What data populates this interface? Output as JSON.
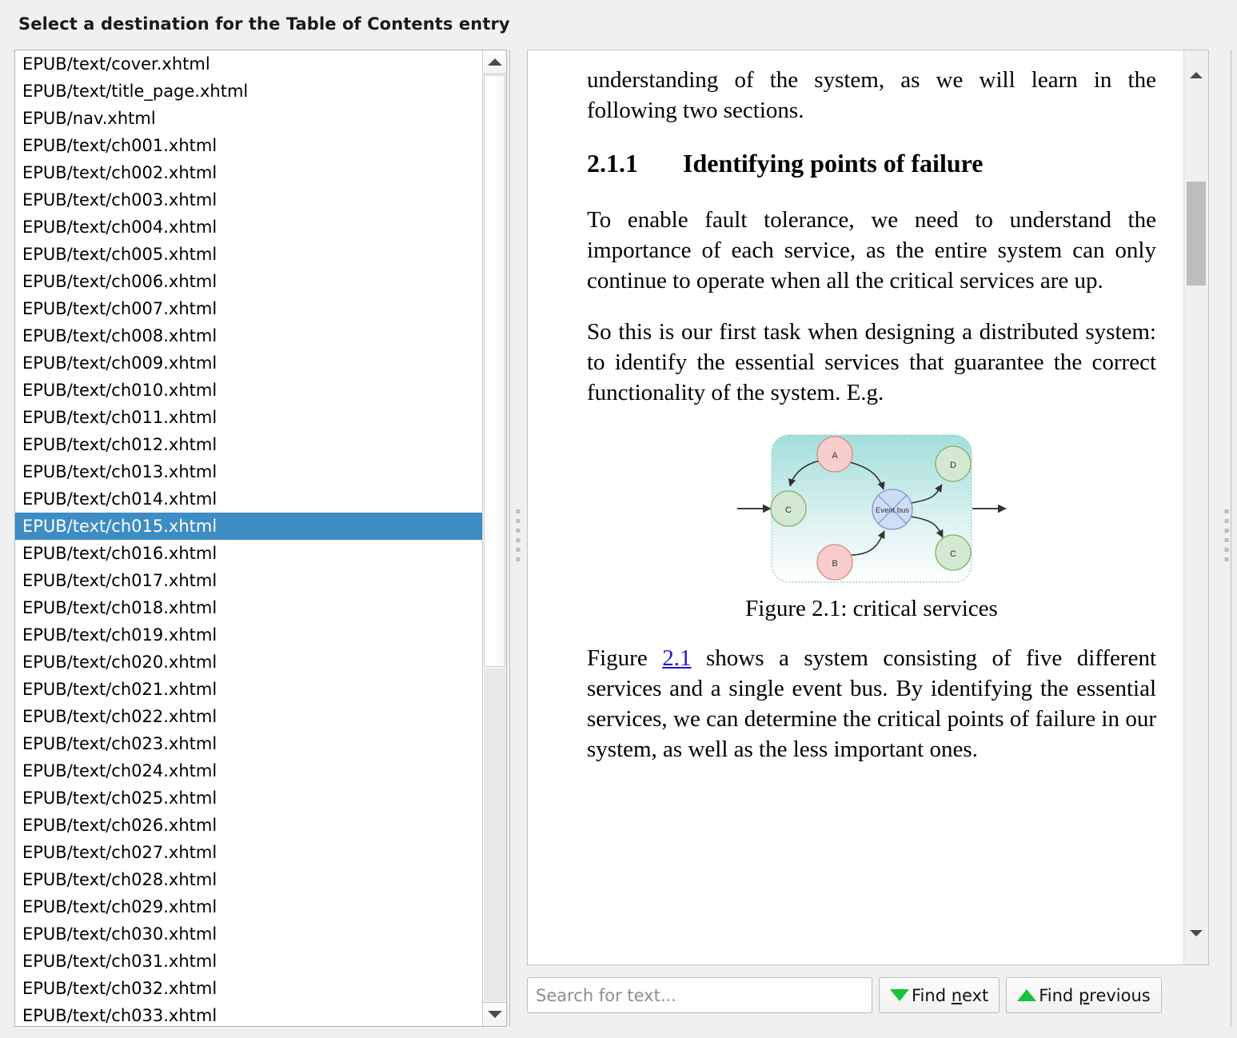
{
  "dialog": {
    "title": "Select a destination for the Table of Contents entry"
  },
  "file_list": {
    "selected": "EPUB/text/ch015.xhtml",
    "items": [
      "EPUB/text/cover.xhtml",
      "EPUB/text/title_page.xhtml",
      "EPUB/nav.xhtml",
      "EPUB/text/ch001.xhtml",
      "EPUB/text/ch002.xhtml",
      "EPUB/text/ch003.xhtml",
      "EPUB/text/ch004.xhtml",
      "EPUB/text/ch005.xhtml",
      "EPUB/text/ch006.xhtml",
      "EPUB/text/ch007.xhtml",
      "EPUB/text/ch008.xhtml",
      "EPUB/text/ch009.xhtml",
      "EPUB/text/ch010.xhtml",
      "EPUB/text/ch011.xhtml",
      "EPUB/text/ch012.xhtml",
      "EPUB/text/ch013.xhtml",
      "EPUB/text/ch014.xhtml",
      "EPUB/text/ch015.xhtml",
      "EPUB/text/ch016.xhtml",
      "EPUB/text/ch017.xhtml",
      "EPUB/text/ch018.xhtml",
      "EPUB/text/ch019.xhtml",
      "EPUB/text/ch020.xhtml",
      "EPUB/text/ch021.xhtml",
      "EPUB/text/ch022.xhtml",
      "EPUB/text/ch023.xhtml",
      "EPUB/text/ch024.xhtml",
      "EPUB/text/ch025.xhtml",
      "EPUB/text/ch026.xhtml",
      "EPUB/text/ch027.xhtml",
      "EPUB/text/ch028.xhtml",
      "EPUB/text/ch029.xhtml",
      "EPUB/text/ch030.xhtml",
      "EPUB/text/ch031.xhtml",
      "EPUB/text/ch032.xhtml",
      "EPUB/text/ch033.xhtml"
    ]
  },
  "preview": {
    "para_top": "understanding of the system, as we will learn in the following two sections.",
    "heading_number": "2.1.1",
    "heading_text": "Identifying points of failure",
    "para_1": "To enable fault tolerance, we need to understand the importance of each service, as the entire system can only continue to operate when all the critical services are up.",
    "para_2": "So this is our first task when designing a distributed system: to identify the essential services that guarantee the correct functionality of the system. E.g.",
    "figure_caption": "Figure 2.1: critical services",
    "para_3_before_link": "Figure ",
    "para_3_link": "2.1",
    "para_3_after_link": " shows a system consisting of five different services and a single event bus. By identifying the essential services, we can determine the critical points of failure in our system, as well as the less important ones.",
    "diagram": {
      "nodes": [
        {
          "label": "A",
          "kind": "service-pink"
        },
        {
          "label": "B",
          "kind": "service-pink"
        },
        {
          "label": "C",
          "kind": "service-green"
        },
        {
          "label": "C",
          "kind": "service-green"
        },
        {
          "label": "D",
          "kind": "service-green"
        },
        {
          "label": "Event bus",
          "kind": "event-bus"
        }
      ],
      "colors": {
        "pink_fill": "#f8cecc",
        "pink_stroke": "#e08b85",
        "green_fill": "#d5e8d4",
        "green_stroke": "#82b366",
        "bus_fill": "#cfdcf5",
        "bus_stroke": "#7a93cf",
        "box_fill_top": "#a8e0dd",
        "box_fill_bottom": "#ffffff",
        "box_stroke": "#8fd3d0"
      }
    }
  },
  "searchbar": {
    "placeholder": "Search for text...",
    "value": "",
    "find_next": "Find next",
    "find_next_pre": "Find ",
    "find_next_key": "n",
    "find_next_post": "ext",
    "find_prev_pre": "Find ",
    "find_prev_key": "p",
    "find_prev_post": "revious"
  }
}
